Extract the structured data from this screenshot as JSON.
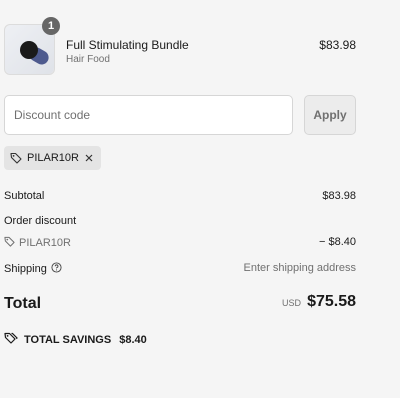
{
  "product": {
    "quantity": "1",
    "name": "Full Stimulating Bundle",
    "vendor": "Hair Food",
    "price": "$83.98"
  },
  "discount": {
    "placeholder": "Discount code",
    "apply_label": "Apply"
  },
  "applied_code": {
    "code": "PILAR10R",
    "remove_icon": "close-icon"
  },
  "summary": {
    "subtotal_label": "Subtotal",
    "subtotal_value": "$83.98",
    "order_discount_label": "Order discount",
    "discount_code": "PILAR10R",
    "discount_value": "− $8.40",
    "shipping_label": "Shipping",
    "shipping_value": "Enter shipping address",
    "total_label": "Total",
    "currency": "USD",
    "total_value": "$75.58"
  },
  "savings": {
    "label": "TOTAL SAVINGS",
    "value": "$8.40"
  },
  "icons": [
    "tag-icon",
    "close-icon",
    "help-circle-icon",
    "savings-tag-icon"
  ],
  "colors": {
    "background": "#f5f5f5",
    "muted_text": "#707070",
    "badge": "#666666",
    "chip": "#e4e4e4"
  }
}
